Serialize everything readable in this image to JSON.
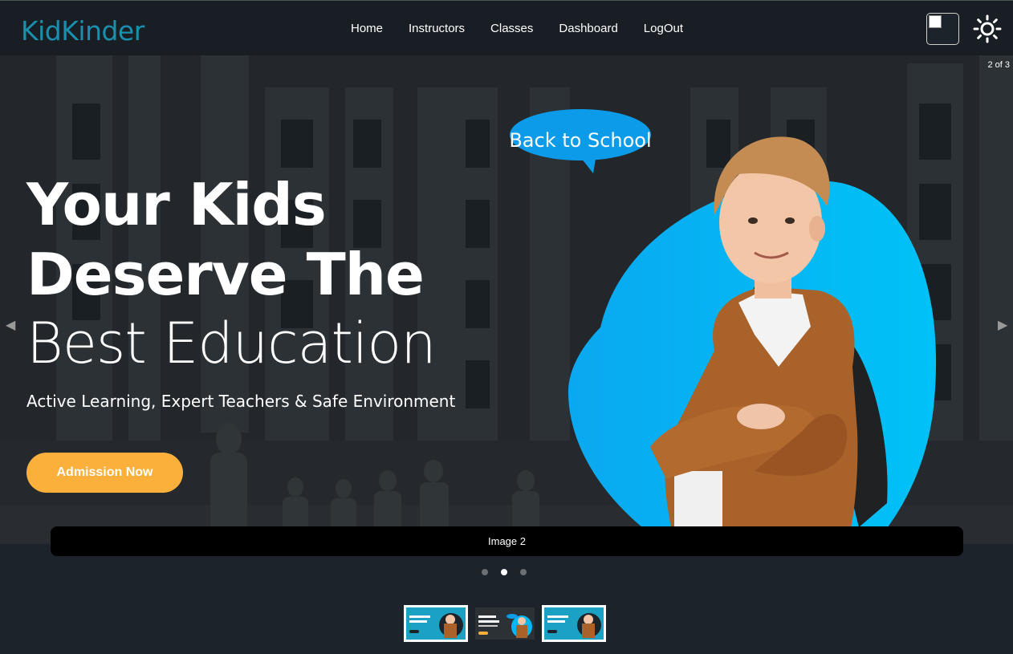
{
  "brand": "KidKinder",
  "nav": {
    "links": [
      "Home",
      "Instructors",
      "Classes",
      "Dashboard",
      "LogOut"
    ]
  },
  "icons": {
    "avatar": "broken-image-icon",
    "theme": "sun-icon"
  },
  "colors": {
    "brand": "#1a8fae",
    "cta": "#fbb03b",
    "blob": "#00b8f5",
    "nav_bg": "#191e24",
    "page_bg": "#1d232a"
  },
  "carousel": {
    "counter": "2 of 3",
    "current_index": 2,
    "total": 3,
    "caption": "Image 2"
  },
  "hero": {
    "title_line1": "Your Kids",
    "title_line2": "Deserve The",
    "title_line3": "Best Education",
    "subtitle": "Active Learning, Expert Teachers & Safe Environment",
    "cta_label": "Admission Now",
    "bubble_text": "Back to School"
  },
  "arrows": {
    "left": "◀",
    "right": "▶"
  }
}
